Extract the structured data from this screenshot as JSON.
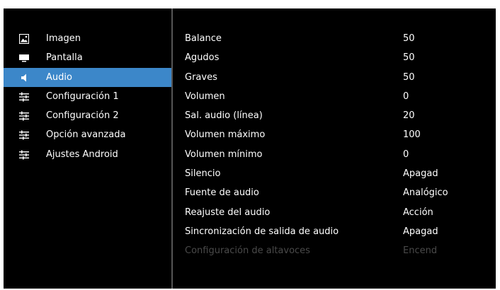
{
  "sidebar": {
    "items": [
      {
        "label": "Imagen",
        "icon": "image-icon"
      },
      {
        "label": "Pantalla",
        "icon": "monitor-icon"
      },
      {
        "label": "Audio",
        "icon": "speaker-icon",
        "active": true
      },
      {
        "label": "Configuración 1",
        "icon": "sliders-icon"
      },
      {
        "label": "Configuración 2",
        "icon": "sliders-icon"
      },
      {
        "label": "Opción avanzada",
        "icon": "sliders-icon"
      },
      {
        "label": "Ajustes Android",
        "icon": "sliders-icon"
      }
    ]
  },
  "settings": {
    "rows": [
      {
        "label": "Balance",
        "value": "50"
      },
      {
        "label": "Agudos",
        "value": "50"
      },
      {
        "label": "Graves",
        "value": "50"
      },
      {
        "label": "Volumen",
        "value": "0"
      },
      {
        "label": "Sal. audio (línea)",
        "value": "20"
      },
      {
        "label": "Volumen máximo",
        "value": "100"
      },
      {
        "label": "Volumen mínimo",
        "value": "0"
      },
      {
        "label": "Silencio",
        "value": "Apagad"
      },
      {
        "label": "Fuente de audio",
        "value": "Analógico"
      },
      {
        "label": "Reajuste del audio",
        "value": "Acción"
      },
      {
        "label": "Sincronización de salida de audio",
        "value": "Apagad"
      },
      {
        "label": "Configuración de altavoces",
        "value": "Encend",
        "disabled": true
      }
    ]
  },
  "colors": {
    "background": "#000000",
    "accent": "#3c87c9",
    "text": "#ffffff",
    "disabled_text": "#4a4a4a",
    "divider": "#555555"
  }
}
